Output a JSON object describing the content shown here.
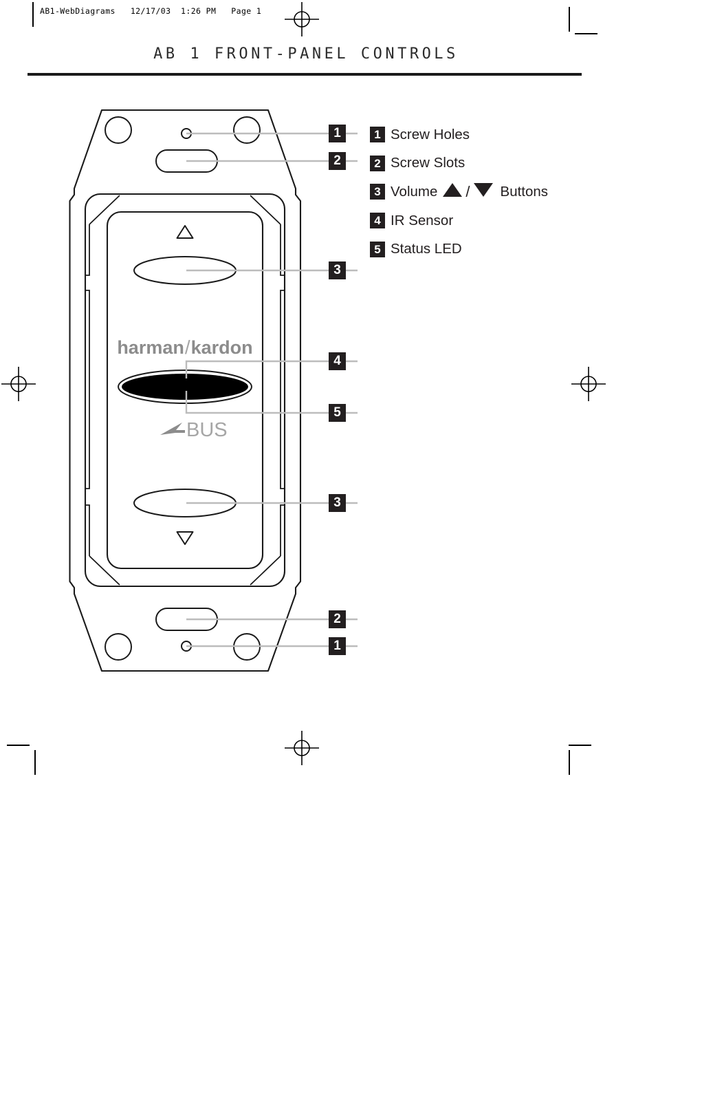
{
  "page": {
    "slug": "AB1-WebDiagrams   12/17/03  1:26 PM   Page 1",
    "title": "AB 1 FRONT-PANEL CONTROLS"
  },
  "legend": {
    "items": [
      {
        "number": "1",
        "label": "Screw Holes"
      },
      {
        "number": "2",
        "label": "Screw Slots"
      },
      {
        "number": "3",
        "label_before": "Volume",
        "label_after": "Buttons",
        "icons": [
          "triangle-up",
          "triangle-down"
        ]
      },
      {
        "number": "4",
        "label": "IR Sensor"
      },
      {
        "number": "5",
        "label": "Status LED"
      }
    ],
    "separator": "/"
  },
  "diagram": {
    "brand_logo": "harman/kardon",
    "brand_logo_primary": "harman",
    "brand_logo_separator": "/",
    "brand_logo_secondary": "kardon",
    "secondary_logo": "BUS",
    "secondary_logo_full": "A-BUS",
    "callouts": [
      {
        "number": "1",
        "target": "screw-hole-top"
      },
      {
        "number": "2",
        "target": "screw-slot-top"
      },
      {
        "number": "3",
        "target": "volume-up-button"
      },
      {
        "number": "4",
        "target": "ir-sensor"
      },
      {
        "number": "5",
        "target": "status-led"
      },
      {
        "number": "3",
        "target": "volume-down-button"
      },
      {
        "number": "2",
        "target": "screw-slot-bottom"
      },
      {
        "number": "1",
        "target": "screw-hole-bottom"
      }
    ]
  },
  "colors": {
    "ink": "#231f20",
    "line": "#000000",
    "callout_line": "#bcbcbc",
    "logo_gray": "#8c8c8c",
    "logo_light_gray": "#a6a6a6",
    "paper": "#ffffff"
  }
}
